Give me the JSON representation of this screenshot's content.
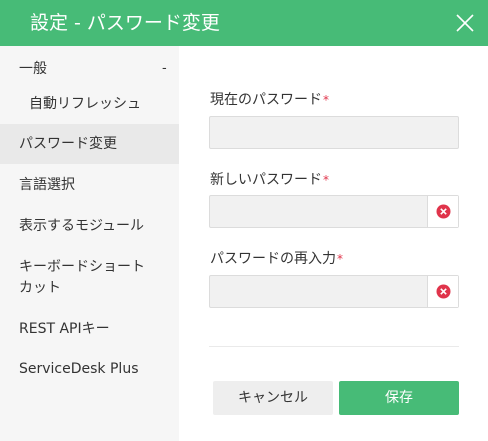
{
  "dialog": {
    "title": "設定 - パスワード変更"
  },
  "sidebar": {
    "items": [
      {
        "label": "一般",
        "toggle": "-"
      },
      {
        "label": "自動リフレッシュ"
      },
      {
        "label": "パスワード変更"
      },
      {
        "label": "言語選択"
      },
      {
        "label": "表示するモジュール"
      },
      {
        "label": "キーボードショート"
      },
      {
        "label": "カット"
      },
      {
        "label": "REST APIキー"
      },
      {
        "label": "ServiceDesk Plus"
      }
    ]
  },
  "form": {
    "current_password": {
      "label": "現在のパスワード",
      "required_mark": "*",
      "value": ""
    },
    "new_password": {
      "label": "新しいパスワード",
      "required_mark": "*",
      "value": ""
    },
    "confirm_password": {
      "label": "パスワードの再入力",
      "required_mark": "*",
      "value": ""
    }
  },
  "actions": {
    "cancel_label": "キャンセル",
    "save_label": "保存"
  },
  "colors": {
    "header": "#47bb77",
    "save_button": "#47bb77",
    "required": "#e0344b",
    "clear_icon": "#e0344b"
  }
}
